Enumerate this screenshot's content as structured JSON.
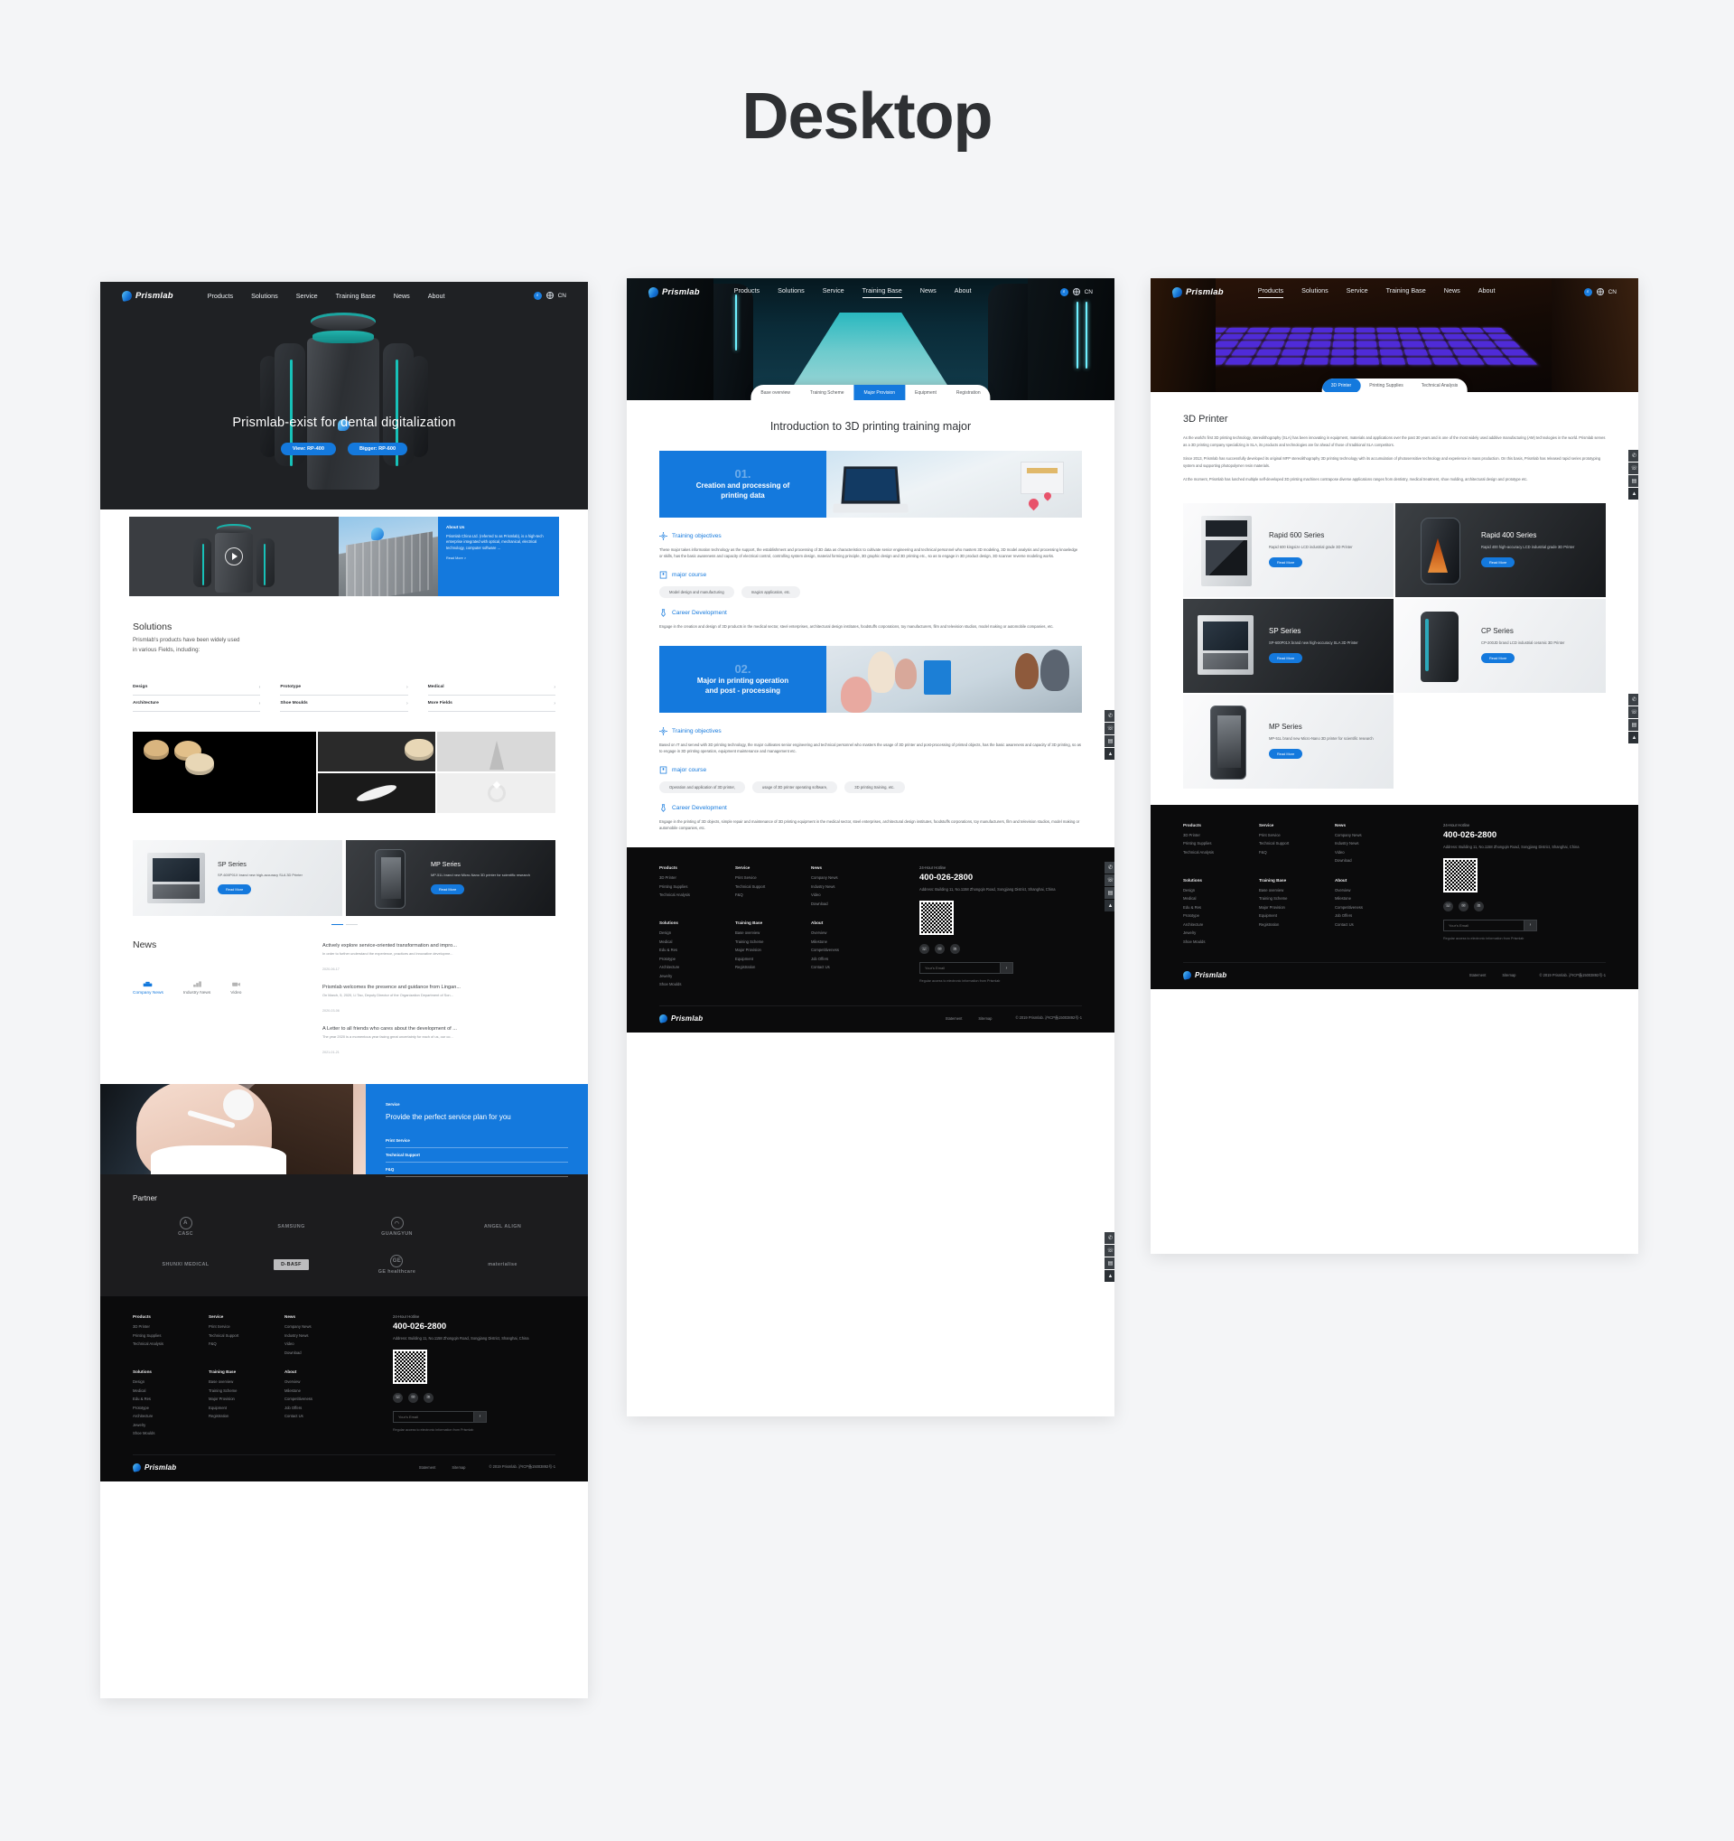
{
  "page": {
    "title": "Desktop"
  },
  "brand": {
    "name": "Prismlab"
  },
  "nav": {
    "items": [
      "Products",
      "Solutions",
      "Service",
      "Training Base",
      "News",
      "About"
    ],
    "search_icon": "search-icon",
    "globe_icon": "globe-icon",
    "lang": "CN"
  },
  "home": {
    "hero": {
      "title": "Prismlab-exist for dental digitalization",
      "btn_view": "View:  RP-400",
      "btn_bigger": "Bigger:  RP-600"
    },
    "about": {
      "label": "About Us",
      "body": "Prismlab China Ltd. (referred to as Prismlab), is a high-tech enterprise integrated with optical, mechanical, electrical technology, computer software ...",
      "more": "Read More >"
    },
    "solutions": {
      "heading": "Solutions",
      "sub": "Prismlab's products have been widely used\nin various Fields, including:",
      "items": [
        "Design",
        "Prototype",
        "Medical",
        "Architecture",
        "Shoe Moulds",
        "More Fields"
      ],
      "arrow": "›"
    },
    "products": [
      {
        "name": "SP Series",
        "desc": "SP-600P01X brand new high-accuracy SLA 3D Printer",
        "cta": "Read More"
      },
      {
        "name": "MP Series",
        "desc": "MP-51L brand new Micro-Nano 3D printer for scientific research",
        "cta": "Read More"
      }
    ],
    "news": {
      "heading": "News",
      "tabs": [
        "Company News",
        "Industry News",
        "Video"
      ],
      "active_tab": "Company News",
      "items": [
        {
          "title": "Actively explore service-oriented transformation and impro...",
          "summary": "In order to further understand the experience, practices and innovative developme...",
          "date": "2020-06-17"
        },
        {
          "title": "Prismlab welcomes the presence and guidance from Lingan...",
          "summary": "On March, 5, 2020, Li Tao, Deputy Director of the Organization Department of Son...",
          "date": "2020-03-06"
        },
        {
          "title": "A Letter to all friends who cares about the development of ...",
          "summary": "The year 2020 is a momentous year facing great uncertainty for each of us, our co...",
          "date": "2021-01-21"
        }
      ]
    },
    "service": {
      "label": "Service",
      "title": "Provide the perfect service plan for you",
      "links": [
        "Print Service",
        "Technical Support",
        "F&Q"
      ]
    },
    "partner": {
      "heading": "Partner",
      "logos": [
        "CASC",
        "SAMSUNG",
        "GUANGYUN",
        "ANGEL ALIGN",
        "SHUNXI MEDICAL",
        "D-BASF",
        "GE healthcare",
        "materialise"
      ]
    }
  },
  "training": {
    "subtabs": [
      "Base overview",
      "Training Scheme",
      "Major Provision",
      "Equipment",
      "Registration"
    ],
    "active_subtab": "Major Provision",
    "page_title": "Introduction to 3D printing training major",
    "majors": [
      {
        "num": "01.",
        "title": "Creation and processing of\nprinting data",
        "objectives_label": "Training objectives",
        "objectives": "These major takes information technology as the support, the establishment and processing of 3D data as characteristics to cultivate senior engineering and technical personnel who masters 3D modeling, 3D model analysis and processing knowledge or skills, has the basic awareness and capacity of electrical control, controlling system design, material forming principle, 3D graphic design and 3D printing etc., so as to engage in 3D product design, 3D scanner reverse modeling works.",
        "course_label": "major course",
        "courses": [
          "Model design and manufacturing",
          "magics application, etc."
        ],
        "career_label": "Career Development",
        "career": "Engage in the creation and design of 3D products in the medical sector, steel enterprises, architectural design institutes, foodstuffs corporations, toy manufacturers, film and television studios, model making or automobile companies, etc."
      },
      {
        "num": "02.",
        "title": "Major in printing operation\nand post - processing",
        "objectives_label": "Training objectives",
        "objectives": "Based on IT and served with 3D printing technology, the major cultivates senior engineering and technical personnel who masters the usage of 3D printer and post-processing of printed objects, has the basic awareness and capacity of 3D printing, so as to engage in 3D printing operation, equipment maintenance and management etc.",
        "course_label": "major course",
        "courses": [
          "Operation and application of 3D printer,",
          "usage of 3D printer operating software,",
          "3D printing training, etc."
        ],
        "career_label": "Career Development",
        "career": "Engage in the printing of 3D objects, simple repair and maintenance of 3D printing equipment in the medical sector, steel enterprises, architectural design institutes, foodstuffs corporations, toy manufacturers, film and television studios, model making or automobile companies, etc."
      }
    ]
  },
  "printer": {
    "tabs": [
      "3D Printer",
      "Printing Supplies",
      "Technical Analysis"
    ],
    "active_tab": "3D Printer",
    "heading": "3D Printer",
    "paragraphs": [
      "As the world's first 3D printing technology, stereolithography (SLA) has been innovating in equipment, materials and applications over the past 30 years and is one of the most widely used additive manufacturing (AM) technologies in the world. Prismlab serves as a 3D printing company specializing in SLA, its products and technologies are far ahead of those of traditional SLA competitors.",
      "Since 2013, Prismlab has successfully developed its original MFP stereolithography 3D printing technology with its accumulation of photosensitive technology and experience in mass production. On this basis, Prismlab has released rapid series prototyping system and supporting photopolymer resin materials.",
      "At the moment, Prismlab has lunched multiple self-developed 3D printing machines contrapose diverse applications ranges from dentistry, medical treatment, shoe molding, architectural design and prototype etc."
    ],
    "cards": [
      {
        "name": "Rapid 600 Series",
        "desc": "Rapid 600 kingsize LCD industrial grade 3D Printer",
        "cta": "Read More"
      },
      {
        "name": "Rapid 400 Series",
        "desc": "Rapid 400 high-accuracy LCD industrial grade 3D Printer",
        "cta": "Read More"
      },
      {
        "name": "SP Series",
        "desc": "SP-600P01X brand new high-accuracy SLA 3D Printer",
        "cta": "Read More"
      },
      {
        "name": "CP Series",
        "desc": "CP-200JD brand LCD industrial ceramic 3D Printer",
        "cta": "Read More"
      },
      {
        "name": "MP Series",
        "desc": "MP-51L brand new Micro-Nano 3D printer for scientific research",
        "cta": "Read More"
      }
    ]
  },
  "footer": {
    "columns": [
      {
        "heading": "Products",
        "links": [
          "3D Printer",
          "Printing Supplies",
          "Technical Analysis"
        ]
      },
      {
        "heading": "Service",
        "links": [
          "Print Service",
          "Technical Support",
          "F&Q"
        ]
      },
      {
        "heading": "News",
        "links": [
          "Company News",
          "Industry News",
          "Video",
          "Download"
        ]
      },
      {
        "heading": "Solutions",
        "links": [
          "Design",
          "Medical",
          "Edu & Res",
          "Prototype",
          "Architecture",
          "Jewelry",
          "Shoe Moulds"
        ]
      },
      {
        "heading": "Training Base",
        "links": [
          "Base overview",
          "Training Scheme",
          "Major Provision",
          "Equipment",
          "Registration"
        ]
      },
      {
        "heading": "About",
        "links": [
          "Overview",
          "Milestone",
          "Competitiveness",
          "Job Offers",
          "Contact Us"
        ]
      }
    ],
    "contact": {
      "hotline_label": "24-Hour Hotline",
      "hotline": "400-026-2800",
      "address": "Address:  Building 11, No.1158 Zhongqin Road, Songjiang District, Shanghai, China",
      "email_placeholder": "Your's Email",
      "submit_icon": "arrow-right-icon",
      "note": "Regular access to electronic information from Prismlab"
    },
    "social": [
      "wechat-icon",
      "weibo-icon",
      "linkedin-icon"
    ],
    "bar": {
      "statement": "Statement",
      "sitemap": "Sitemap",
      "copyright": "© 2019 Prismlab.  沪ICP备15003892号-1"
    }
  },
  "widgets": {
    "icons": [
      "phone-icon",
      "service-icon",
      "message-icon",
      "back-to-top-icon"
    ]
  },
  "colors": {
    "accent": "#1479dd",
    "dark": "#1c1c1e",
    "teal": "#17c1b8"
  }
}
